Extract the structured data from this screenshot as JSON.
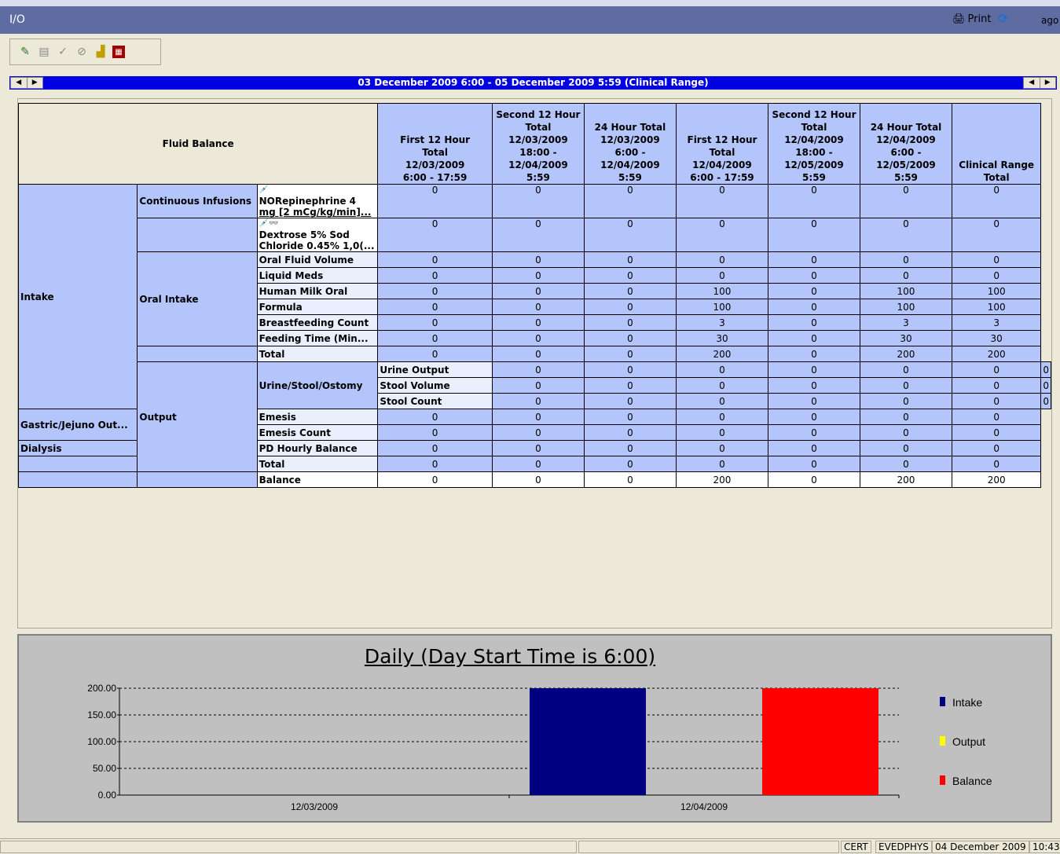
{
  "window": {
    "title": "I/O",
    "print_label": "Print",
    "ago_label": "ago"
  },
  "toolbar": {
    "icons": [
      "new-icon",
      "notes-icon",
      "check-icon",
      "cancel-icon",
      "chart-icon",
      "calculator-icon"
    ]
  },
  "range": {
    "label": "03 December 2009 6:00 - 05 December 2009 5:59 (Clinical Range)"
  },
  "grid": {
    "corner_label": "Fluid Balance",
    "columns": [
      [
        "First 12 Hour",
        "Total",
        "12/03/2009",
        "6:00 - 17:59"
      ],
      [
        "Second 12 Hour",
        "Total",
        "12/03/2009",
        "18:00 -",
        "12/04/2009",
        "5:59"
      ],
      [
        "24 Hour Total",
        "12/03/2009",
        "6:00 -",
        "12/04/2009",
        "5:59"
      ],
      [
        "First 12 Hour",
        "Total",
        "12/04/2009",
        "6:00 - 17:59"
      ],
      [
        "Second 12 Hour",
        "Total",
        "12/04/2009",
        "18:00 -",
        "12/05/2009",
        "5:59"
      ],
      [
        "24 Hour Total",
        "12/04/2009",
        "6:00 -",
        "12/05/2009",
        "5:59"
      ],
      [
        "Clinical Range",
        "Total"
      ]
    ],
    "groups": {
      "intake": "Intake",
      "output": "Output"
    },
    "subgroups": {
      "continuous": "Continuous Infusions",
      "oral": "Oral Intake",
      "urine": "Urine/Stool/Ostomy",
      "gastric": "Gastric/Jejuno Out...",
      "dialysis": "Dialysis"
    },
    "meds": [
      {
        "line1": "NORepinephrine 4",
        "line2": "mg [2 mCg/kg/min]...",
        "values": [
          "0",
          "0",
          "0",
          "0",
          "0",
          "0",
          "0"
        ]
      },
      {
        "line1": "Dextrose 5% Sod",
        "line2": "Chloride 0.45% 1,0(...",
        "values": [
          "0",
          "0",
          "0",
          "0",
          "0",
          "0",
          "0"
        ]
      }
    ],
    "rows": {
      "oral_fluid": {
        "label": "Oral Fluid Volume",
        "values": [
          "0",
          "0",
          "0",
          "0",
          "0",
          "0",
          "0"
        ]
      },
      "liquid_meds": {
        "label": "Liquid Meds",
        "values": [
          "0",
          "0",
          "0",
          "0",
          "0",
          "0",
          "0"
        ]
      },
      "human_milk": {
        "label": "Human Milk Oral",
        "values": [
          "0",
          "0",
          "0",
          "100",
          "0",
          "100",
          "100"
        ]
      },
      "formula": {
        "label": "Formula",
        "values": [
          "0",
          "0",
          "0",
          "100",
          "0",
          "100",
          "100"
        ]
      },
      "breastfeeding": {
        "label": "Breastfeeding Count",
        "values": [
          "0",
          "0",
          "0",
          "3",
          "0",
          "3",
          "3"
        ]
      },
      "feeding_time": {
        "label": "Feeding Time (Min...",
        "values": [
          "0",
          "0",
          "0",
          "30",
          "0",
          "30",
          "30"
        ]
      },
      "intake_total": {
        "label": "Total",
        "values": [
          "0",
          "0",
          "0",
          "200",
          "0",
          "200",
          "200"
        ]
      },
      "urine": {
        "label": "Urine Output",
        "values": [
          "0",
          "0",
          "0",
          "0",
          "0",
          "0",
          "0"
        ]
      },
      "stool_vol": {
        "label": "Stool Volume",
        "values": [
          "0",
          "0",
          "0",
          "0",
          "0",
          "0",
          "0"
        ]
      },
      "stool_count": {
        "label": "Stool Count",
        "values": [
          "0",
          "0",
          "0",
          "0",
          "0",
          "0",
          "0"
        ]
      },
      "emesis": {
        "label": "Emesis",
        "values": [
          "0",
          "0",
          "0",
          "0",
          "0",
          "0",
          "0"
        ]
      },
      "emesis_count": {
        "label": "Emesis Count",
        "values": [
          "0",
          "0",
          "0",
          "0",
          "0",
          "0",
          "0"
        ]
      },
      "pd_balance": {
        "label": "PD Hourly Balance",
        "values": [
          "0",
          "0",
          "0",
          "0",
          "0",
          "0",
          "0"
        ]
      },
      "output_total": {
        "label": "Total",
        "values": [
          "0",
          "0",
          "0",
          "0",
          "0",
          "0",
          "0"
        ]
      },
      "balance": {
        "label": "Balance",
        "values": [
          "0",
          "0",
          "0",
          "200",
          "0",
          "200",
          "200"
        ]
      }
    }
  },
  "chart_data": {
    "type": "bar",
    "title": "Daily (Day Start Time is 6:00)",
    "categories": [
      "12/03/2009",
      "12/04/2009"
    ],
    "series": [
      {
        "name": "Intake",
        "values": [
          0,
          200
        ],
        "color": "#000080"
      },
      {
        "name": "Output",
        "values": [
          0,
          0
        ],
        "color": "#ffff00"
      },
      {
        "name": "Balance",
        "values": [
          0,
          200
        ],
        "color": "#ff0000"
      }
    ],
    "ylim": [
      0,
      200
    ],
    "yticks": [
      "200.00",
      "150.00",
      "100.00",
      "50.00",
      "0.00"
    ],
    "grid": true,
    "legend": "right"
  },
  "status": {
    "cert": "CERT",
    "user": "EVEDPHYS",
    "date": "04 December 2009",
    "time": "10:43"
  }
}
